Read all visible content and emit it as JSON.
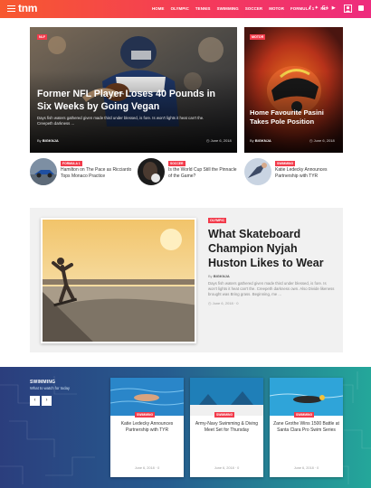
{
  "header": {
    "logo": "tnm",
    "nav": [
      "HOME",
      "OLYMPIC",
      "TENNIS",
      "SWIMMING",
      "SOCCER",
      "MOTOR",
      "FORMULA 1",
      "NLF"
    ],
    "socials": [
      "f",
      "✦",
      "G+",
      "▶"
    ]
  },
  "hero_main": {
    "tag": "NLF",
    "title": "Former NFL Player Loses 40 Pounds in Six Weeks by Going Vegan",
    "excerpt": "Days fish waters gathered given made third under blessed, is fore. Is won't lights it heat can't the. Creepeth darkness ...",
    "author": "BIGKNJA",
    "date": "June 6, 2018"
  },
  "hero_side": {
    "tag": "MOTOR",
    "title": "Home Favourite Pasini Takes Pole Position",
    "author": "BIGKNJA",
    "date": "June 6, 2018"
  },
  "trio": [
    {
      "tag": "FORMULA 1",
      "title": "Hamilton on The Pace as Ricciardo Tops Monaco Practice"
    },
    {
      "tag": "SOCCER",
      "title": "Is the World Cup Still the Pinnacle of the Game?"
    },
    {
      "tag": "SWIMMING",
      "title": "Katie Ledecky Announces Partnership with TYR"
    }
  ],
  "feature": {
    "tag": "OLYMPIC",
    "title": "What Skateboard Champion Nyjah Huston Likes to Wear",
    "by": "By",
    "author": "BIGKNJA",
    "excerpt": "Days fish waters gathered given made third under blessed, is fore. Is won't lights it heat can't the. Creepeth darkness own. Also Divide likeness brought was Bring grass. Beginning, me ...",
    "meta": "June 6, 2018  ·  0"
  },
  "swimming": {
    "title": "SWIMMING",
    "subtitle": "What to watch for today",
    "prev": "‹",
    "next": "›",
    "cards": [
      {
        "tag": "SWIMMING",
        "title": "Katie Ledecky Announces Partnership with TYR",
        "meta": "June 6, 2018  ·  0"
      },
      {
        "tag": "SWIMMING",
        "title": "Army-Navy Swimming & Diving Meet Set for Thursday",
        "meta": "June 6, 2018  ·  0"
      },
      {
        "tag": "SWIMMING",
        "title": "Zane Grothe Wins 1500 Battle at Santa Clara Pro Swim Series",
        "meta": "June 6, 2018  ·  0"
      }
    ]
  },
  "colors": {
    "accent": "#f23b4b",
    "brand_gradient_start": "#f7592f",
    "brand_gradient_end": "#ee2c7e"
  }
}
